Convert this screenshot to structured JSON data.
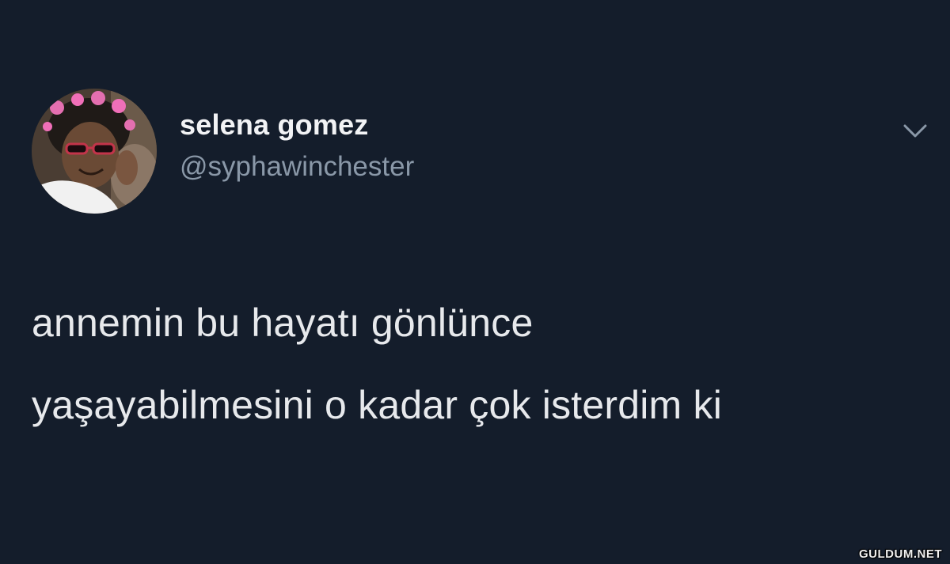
{
  "user": {
    "display_name": "selena gomez",
    "handle": "@syphawinchester"
  },
  "tweet": {
    "lines": [
      "annemin bu hayatı gönlünce",
      "yaşayabilmesini o kadar çok isterdim ki"
    ]
  },
  "icons": {
    "menu": "chevron-down-icon",
    "avatar": "profile-photo"
  },
  "watermark": "GULDUM.NET",
  "colors": {
    "background": "#141d2b",
    "name": "#f2f3f5",
    "handle": "#8a98a8",
    "text": "#e7e9ec"
  }
}
